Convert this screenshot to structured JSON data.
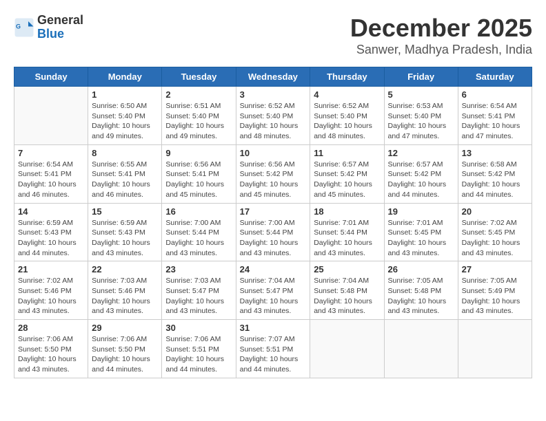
{
  "logo": {
    "line1": "General",
    "line2": "Blue"
  },
  "title": "December 2025",
  "location": "Sanwer, Madhya Pradesh, India",
  "weekdays": [
    "Sunday",
    "Monday",
    "Tuesday",
    "Wednesday",
    "Thursday",
    "Friday",
    "Saturday"
  ],
  "weeks": [
    [
      {
        "day": "",
        "info": ""
      },
      {
        "day": "1",
        "info": "Sunrise: 6:50 AM\nSunset: 5:40 PM\nDaylight: 10 hours\nand 49 minutes."
      },
      {
        "day": "2",
        "info": "Sunrise: 6:51 AM\nSunset: 5:40 PM\nDaylight: 10 hours\nand 49 minutes."
      },
      {
        "day": "3",
        "info": "Sunrise: 6:52 AM\nSunset: 5:40 PM\nDaylight: 10 hours\nand 48 minutes."
      },
      {
        "day": "4",
        "info": "Sunrise: 6:52 AM\nSunset: 5:40 PM\nDaylight: 10 hours\nand 48 minutes."
      },
      {
        "day": "5",
        "info": "Sunrise: 6:53 AM\nSunset: 5:40 PM\nDaylight: 10 hours\nand 47 minutes."
      },
      {
        "day": "6",
        "info": "Sunrise: 6:54 AM\nSunset: 5:41 PM\nDaylight: 10 hours\nand 47 minutes."
      }
    ],
    [
      {
        "day": "7",
        "info": "Sunrise: 6:54 AM\nSunset: 5:41 PM\nDaylight: 10 hours\nand 46 minutes."
      },
      {
        "day": "8",
        "info": "Sunrise: 6:55 AM\nSunset: 5:41 PM\nDaylight: 10 hours\nand 46 minutes."
      },
      {
        "day": "9",
        "info": "Sunrise: 6:56 AM\nSunset: 5:41 PM\nDaylight: 10 hours\nand 45 minutes."
      },
      {
        "day": "10",
        "info": "Sunrise: 6:56 AM\nSunset: 5:42 PM\nDaylight: 10 hours\nand 45 minutes."
      },
      {
        "day": "11",
        "info": "Sunrise: 6:57 AM\nSunset: 5:42 PM\nDaylight: 10 hours\nand 45 minutes."
      },
      {
        "day": "12",
        "info": "Sunrise: 6:57 AM\nSunset: 5:42 PM\nDaylight: 10 hours\nand 44 minutes."
      },
      {
        "day": "13",
        "info": "Sunrise: 6:58 AM\nSunset: 5:42 PM\nDaylight: 10 hours\nand 44 minutes."
      }
    ],
    [
      {
        "day": "14",
        "info": "Sunrise: 6:59 AM\nSunset: 5:43 PM\nDaylight: 10 hours\nand 44 minutes."
      },
      {
        "day": "15",
        "info": "Sunrise: 6:59 AM\nSunset: 5:43 PM\nDaylight: 10 hours\nand 43 minutes."
      },
      {
        "day": "16",
        "info": "Sunrise: 7:00 AM\nSunset: 5:44 PM\nDaylight: 10 hours\nand 43 minutes."
      },
      {
        "day": "17",
        "info": "Sunrise: 7:00 AM\nSunset: 5:44 PM\nDaylight: 10 hours\nand 43 minutes."
      },
      {
        "day": "18",
        "info": "Sunrise: 7:01 AM\nSunset: 5:44 PM\nDaylight: 10 hours\nand 43 minutes."
      },
      {
        "day": "19",
        "info": "Sunrise: 7:01 AM\nSunset: 5:45 PM\nDaylight: 10 hours\nand 43 minutes."
      },
      {
        "day": "20",
        "info": "Sunrise: 7:02 AM\nSunset: 5:45 PM\nDaylight: 10 hours\nand 43 minutes."
      }
    ],
    [
      {
        "day": "21",
        "info": "Sunrise: 7:02 AM\nSunset: 5:46 PM\nDaylight: 10 hours\nand 43 minutes."
      },
      {
        "day": "22",
        "info": "Sunrise: 7:03 AM\nSunset: 5:46 PM\nDaylight: 10 hours\nand 43 minutes."
      },
      {
        "day": "23",
        "info": "Sunrise: 7:03 AM\nSunset: 5:47 PM\nDaylight: 10 hours\nand 43 minutes."
      },
      {
        "day": "24",
        "info": "Sunrise: 7:04 AM\nSunset: 5:47 PM\nDaylight: 10 hours\nand 43 minutes."
      },
      {
        "day": "25",
        "info": "Sunrise: 7:04 AM\nSunset: 5:48 PM\nDaylight: 10 hours\nand 43 minutes."
      },
      {
        "day": "26",
        "info": "Sunrise: 7:05 AM\nSunset: 5:48 PM\nDaylight: 10 hours\nand 43 minutes."
      },
      {
        "day": "27",
        "info": "Sunrise: 7:05 AM\nSunset: 5:49 PM\nDaylight: 10 hours\nand 43 minutes."
      }
    ],
    [
      {
        "day": "28",
        "info": "Sunrise: 7:06 AM\nSunset: 5:50 PM\nDaylight: 10 hours\nand 43 minutes."
      },
      {
        "day": "29",
        "info": "Sunrise: 7:06 AM\nSunset: 5:50 PM\nDaylight: 10 hours\nand 44 minutes."
      },
      {
        "day": "30",
        "info": "Sunrise: 7:06 AM\nSunset: 5:51 PM\nDaylight: 10 hours\nand 44 minutes."
      },
      {
        "day": "31",
        "info": "Sunrise: 7:07 AM\nSunset: 5:51 PM\nDaylight: 10 hours\nand 44 minutes."
      },
      {
        "day": "",
        "info": ""
      },
      {
        "day": "",
        "info": ""
      },
      {
        "day": "",
        "info": ""
      }
    ]
  ]
}
